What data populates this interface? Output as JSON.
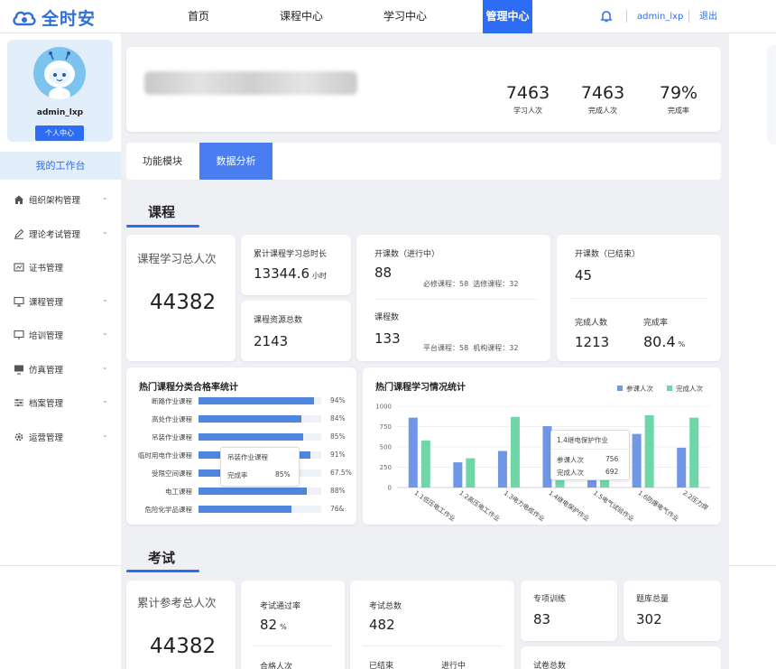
{
  "app": {
    "name": "全时安"
  },
  "nav": {
    "items": [
      "首页",
      "课程中心",
      "学习中心",
      "管理中心"
    ],
    "active": "管理中心"
  },
  "topbar": {
    "user": "admin_lxp",
    "logout": "退出"
  },
  "sidebar": {
    "username": "admin_lxp",
    "profile_button": "个人中心",
    "workbench": "我的工作台",
    "menu": [
      {
        "label": "组织架构管理",
        "icon": "home-icon",
        "expandable": true
      },
      {
        "label": "理论考试管理",
        "icon": "pen-icon",
        "expandable": true
      },
      {
        "label": "证书管理",
        "icon": "certificate-icon",
        "expandable": false
      },
      {
        "label": "课程管理",
        "icon": "monitor-icon",
        "expandable": true
      },
      {
        "label": "培训管理",
        "icon": "screen-icon",
        "expandable": true
      },
      {
        "label": "仿真管理",
        "icon": "display-icon",
        "expandable": true
      },
      {
        "label": "档案管理",
        "icon": "sliders-icon",
        "expandable": true
      },
      {
        "label": "运营管理",
        "icon": "gear-icon",
        "expandable": true
      }
    ]
  },
  "summary": {
    "stats": [
      {
        "value": "7463",
        "label": "学习人次"
      },
      {
        "value": "7463",
        "label": "完成人次"
      },
      {
        "value": "79%",
        "label": "完成率"
      }
    ]
  },
  "tabs": [
    {
      "label": "功能模块",
      "active": false
    },
    {
      "label": "数据分析",
      "active": true
    }
  ],
  "course": {
    "title": "课程",
    "total_label": "课程学习总人次",
    "total_value": "44382",
    "hours_label": "累计课程学习总时长",
    "hours_value": "13344.6",
    "hours_unit": "小时",
    "resources_label": "课程资源总数",
    "resources_value": "2143",
    "ongoing_label": "开课数（进行中）",
    "ongoing_value": "88",
    "required_label": "必修课程：",
    "required_value": "58",
    "elective_label": "选修课程：",
    "elective_value": "32",
    "course_count_label": "课程数",
    "course_count_value": "133",
    "platform_label": "平台课程：",
    "platform_value": "58",
    "org_label": "机构课程：",
    "org_value": "32",
    "ended_label": "开课数（已结束）",
    "ended_value": "45",
    "completed_label": "完成人数",
    "completed_value": "1213",
    "rate_label": "完成率",
    "rate_value": "80.4",
    "rate_unit": "%"
  },
  "hot_pass": {
    "title": "热门课程分类合格率统计",
    "tooltip": {
      "name": "吊装作业课程",
      "label": "完成率",
      "value": "85%"
    }
  },
  "hot_study": {
    "title": "热门课程学习情况统计",
    "tooltip": {
      "name": "1.4继电保护作业",
      "row1_label": "参课人次",
      "row1_value": "756",
      "row2_label": "完成人次",
      "row2_value": "692"
    }
  },
  "exam": {
    "title": "考试",
    "total_label": "累计参考总人次",
    "total_value": "44382",
    "pass_rate_label": "考试通过率",
    "pass_rate_value": "82",
    "pass_rate_unit": "%",
    "pass_count_label": "合格人次",
    "exam_total_label": "考试总数",
    "exam_total_value": "482",
    "ended_label": "已结束",
    "ongoing_label": "进行中",
    "special_label": "专项训练",
    "special_value": "83",
    "bank_label": "题库总量",
    "bank_value": "302",
    "paper_label": "试卷总数"
  },
  "colors": {
    "primary": "#2d6cf5",
    "bar": "#4e86e0",
    "series_a": "#6f97e6",
    "series_b": "#6fd6a8"
  },
  "chart_data": [
    {
      "type": "bar",
      "orientation": "horizontal",
      "title": "热门课程分类合格率统计",
      "categories": [
        "断路作业课程",
        "高处作业课程",
        "吊装作业课程",
        "临时用电作业课程",
        "受限空间课程",
        "电工课程",
        "危险化学品课程"
      ],
      "values": [
        94,
        84,
        85,
        91,
        67.5,
        88,
        76
      ],
      "value_labels": [
        "94%",
        "84%",
        "85%",
        "91%",
        "67.5%",
        "88%",
        "76&"
      ],
      "xlim": [
        0,
        100
      ]
    },
    {
      "type": "bar",
      "title": "热门课程学习情况统计",
      "categories": [
        "1.1低压电工作业",
        "1.2高压电工作业",
        "1.3电力电缆作业",
        "1.4继电保护作业",
        "1.5电气试验作业",
        "1.6防爆电气作业",
        "2.2压力焊"
      ],
      "series": [
        {
          "name": "参课人次",
          "values": [
            860,
            310,
            450,
            756,
            290,
            660,
            490
          ]
        },
        {
          "name": "完成人次",
          "values": [
            580,
            360,
            870,
            692,
            250,
            890,
            860
          ]
        }
      ],
      "yticks": [
        0,
        250,
        500,
        750,
        1000
      ],
      "ylim": [
        0,
        1000
      ],
      "legend": "top-right"
    }
  ]
}
